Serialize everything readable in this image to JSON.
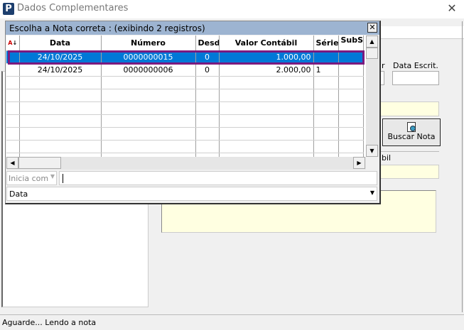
{
  "window": {
    "title": "Dados Complementares",
    "logo": "P",
    "close": "✕"
  },
  "form": {
    "partial_label_left": "r",
    "data_escrit_label": "Data Escrit.",
    "buscar_button": "Buscar Nota",
    "partial_label_bil": "bil"
  },
  "status": "Aguarde... Lendo a nota",
  "popup": {
    "title": "Escolha a Nota correta : (exibindo 2 registros)",
    "close": "✕",
    "columns": [
      "Data",
      "Número",
      "Desd",
      "Valor Contábil",
      "Série",
      "SubS"
    ],
    "rows": [
      {
        "data": "24/10/2025",
        "numero": "0000000015",
        "desd": "0",
        "valor": "1.000,00",
        "serie": "",
        "subs": ""
      },
      {
        "data": "24/10/2025",
        "numero": "0000000006",
        "desd": "0",
        "valor": "2.000,00",
        "serie": "1",
        "subs": ""
      }
    ],
    "filter_mode": "Inicia com",
    "filter_value": "",
    "field": "Data"
  },
  "colors": {
    "selection": "#0078d7",
    "highlight": "#7b1a7f",
    "popup_title": "#9db4d1",
    "field_yellow": "#ffffe1"
  }
}
